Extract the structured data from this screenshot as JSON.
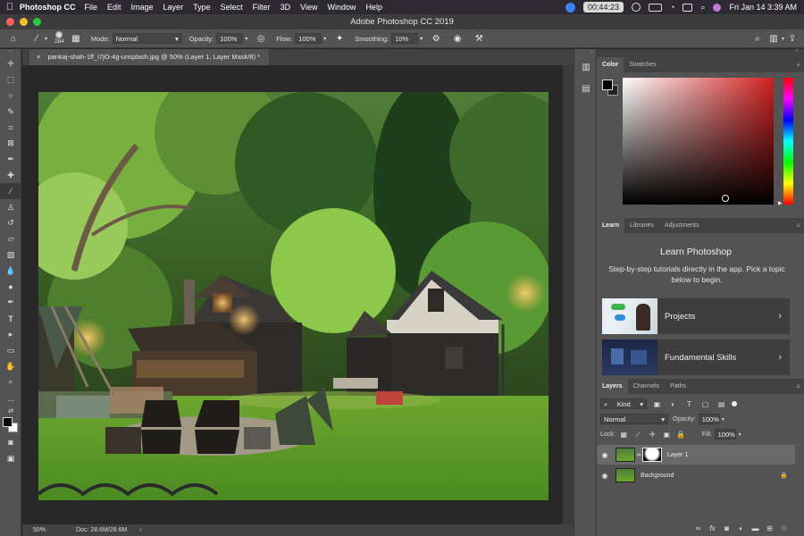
{
  "menubar": {
    "app": "Photoshop CC",
    "items": [
      "File",
      "Edit",
      "Image",
      "Layer",
      "Type",
      "Select",
      "Filter",
      "3D",
      "View",
      "Window",
      "Help"
    ],
    "timer": "00:44:23",
    "datetime": "Fri Jan 14  3:39 AM"
  },
  "titlebar": {
    "title": "Adobe Photoshop CC 2019"
  },
  "options": {
    "brush_size": "284",
    "mode_label": "Mode:",
    "mode_value": "Normal",
    "opacity_label": "Opacity:",
    "opacity_value": "100%",
    "flow_label": "Flow:",
    "flow_value": "100%",
    "smoothing_label": "Smoothing:",
    "smoothing_value": "10%"
  },
  "document": {
    "tab_title": "pankaj-shah-1ff_i7jO-4g-unsplash.jpg @ 50% (Layer 1, Layer Mask/8) *",
    "zoom": "50%",
    "doc_size": "Doc: 28.6M/28.6M"
  },
  "color_panel": {
    "tabs": [
      "Color",
      "Swatches"
    ],
    "accent": "#d22020"
  },
  "learn_panel": {
    "tabs": [
      "Learn",
      "Libraries",
      "Adjustments"
    ],
    "title": "Learn Photoshop",
    "description": "Step-by-step tutorials directly in the app. Pick a topic below to begin.",
    "cards": [
      "Projects",
      "Fundamental Skills"
    ]
  },
  "layers_panel": {
    "tabs": [
      "Layers",
      "Channels",
      "Paths"
    ],
    "filter_kind": "Kind",
    "blend_mode": "Normal",
    "opacity_label": "Opacity:",
    "opacity_value": "100%",
    "lock_label": "Lock:",
    "fill_label": "Fill:",
    "fill_value": "100%",
    "layers": [
      {
        "name": "Layer 1",
        "selected": true
      },
      {
        "name": "Background",
        "selected": false
      }
    ]
  }
}
